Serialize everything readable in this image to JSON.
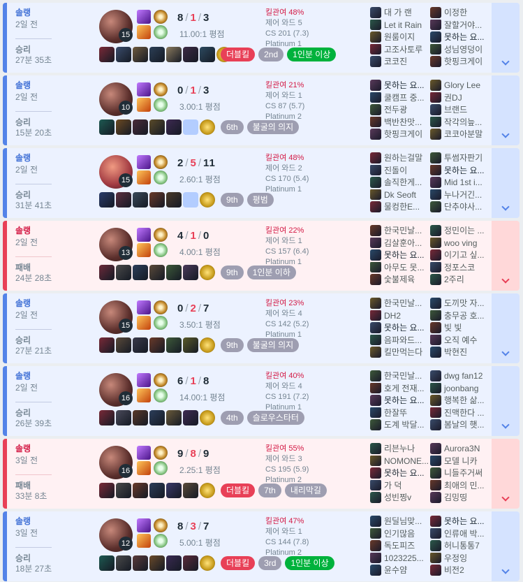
{
  "matches": [
    {
      "result": "win",
      "queue": "솔랭",
      "ago": "2일 전",
      "result_label": "승리",
      "duration": "27분 35초",
      "champion_level": "15",
      "kda": {
        "k": "8",
        "d": "1",
        "a": "3"
      },
      "ratio": "11.00:1 평점",
      "stats": {
        "kp": "킬관여 48%",
        "ward": "제어 와드 5",
        "cs": "CS 201 (7.3)",
        "tier": "Platinum 1"
      },
      "items": [
        "#7a2a38",
        "#3a4c6b",
        "#6f5a3e",
        "#2c3f56",
        "#8a7a5e",
        "#3c2a45",
        "#2d4a60"
      ],
      "tags": [
        {
          "text": "더블킬",
          "style": "mk"
        },
        {
          "text": "2nd",
          "style": "gy"
        },
        {
          "text": "1인분 이상",
          "style": "g2"
        }
      ],
      "team1": [
        "대 가 랜",
        "Let it Rain",
        "원룸이지",
        "고조사토루",
        "코코진"
      ],
      "team2": [
        "이정한",
        "잘할거야...",
        "못하는 요...",
        "성님영덩이",
        "핫핑크게이"
      ]
    },
    {
      "result": "win",
      "queue": "솔랭",
      "ago": "2일 전",
      "result_label": "승리",
      "duration": "15분 20초",
      "champion_level": "10",
      "kda": {
        "k": "0",
        "d": "1",
        "a": "3"
      },
      "ratio": "3.00:1 평점",
      "stats": {
        "kp": "킬관여 21%",
        "ward": "제어 와드 1",
        "cs": "CS 87 (5.7)",
        "tier": "Platinum 2"
      },
      "items": [
        "#1e5a52",
        "#6d4a22",
        "#4a2c3a",
        "#5b4b2a",
        "#3e2a52",
        "empty"
      ],
      "tags": [
        {
          "text": "6th",
          "style": "gy"
        },
        {
          "text": "불굴의 의지",
          "style": "gy"
        }
      ],
      "team1": [
        "못하는 요...",
        "쿨캠프 중...",
        "전두광",
        "백반찬맛...",
        "핫핑크게이"
      ],
      "team2": [
        "Glory Lee",
        "권DJ",
        "브랜드",
        "작각의늪...",
        "코코아분말"
      ]
    },
    {
      "result": "win",
      "queue": "솔랭",
      "ago": "2일 전",
      "result_label": "승리",
      "duration": "31분 41초",
      "champion_level": "15",
      "kda": {
        "k": "2",
        "d": "5",
        "a": "11"
      },
      "ratio": "2.60:1 평점",
      "stats": {
        "kp": "킬관여 48%",
        "ward": "제어 와드 2",
        "cs": "CS 170 (5.4)",
        "tier": "Platinum 1"
      },
      "items": [
        "#2a3c6b",
        "#5c2f40",
        "#3a4a5a",
        "#6a3a2a",
        "#4a3a2a",
        "empty"
      ],
      "tags": [
        {
          "text": "9th",
          "style": "gy"
        },
        {
          "text": "평범",
          "style": "gy"
        }
      ],
      "team1": [
        "원하는걸말",
        "진돌이",
        "솔직한게...",
        "Dk Seoft",
        "물컹한E..."
      ],
      "team2": [
        "투썸자판기",
        "못하는 요...",
        "Mid 1st i...",
        "누나거긴...",
        "단추야사..."
      ]
    },
    {
      "result": "lose",
      "queue": "솔랭",
      "ago": "2일 전",
      "result_label": "패배",
      "duration": "24분 28초",
      "champion_level": "13",
      "kda": {
        "k": "4",
        "d": "1",
        "a": "0"
      },
      "ratio": "4.00:1 평점",
      "stats": {
        "kp": "킬관여 22%",
        "ward": "제어 와드 1",
        "cs": "CS 157 (6.4)",
        "tier": "Platinum 1"
      },
      "items": [
        "#6b2a3a",
        "#4a4a4a",
        "#2c3e5a",
        "#5a4a3a",
        "#3e5a3a",
        "#4a3a5a"
      ],
      "tags": [
        {
          "text": "9th",
          "style": "gy"
        },
        {
          "text": "1인분 이하",
          "style": "gy"
        }
      ],
      "team1": [
        "한국민날...",
        "김살훈아...",
        "못하는 요...",
        "아무도 못...",
        "숯불제육"
      ],
      "team2": [
        "정민이는 ...",
        "woo ving",
        "이기고 싶...",
        "정포스코",
        "2주리"
      ]
    },
    {
      "result": "win",
      "queue": "솔랭",
      "ago": "2일 전",
      "result_label": "승리",
      "duration": "27분 21초",
      "champion_level": "15",
      "kda": {
        "k": "0",
        "d": "2",
        "a": "7"
      },
      "ratio": "3.50:1 평점",
      "stats": {
        "kp": "킬관여 23%",
        "ward": "제어 와드 4",
        "cs": "CS 142 (5.2)",
        "tier": "Platinum 1"
      },
      "items": [
        "#7a2a38",
        "#5a4a3a",
        "#3a3a4a",
        "#6a3a2a",
        "#3e5a3a",
        "#5a5a2a"
      ],
      "tags": [
        {
          "text": "9th",
          "style": "gy"
        },
        {
          "text": "불굴의 의지",
          "style": "gy"
        }
      ],
      "team1": [
        "한국민날...",
        "DH2",
        "못하는 요...",
        "음파와드...",
        "킬만먹는다"
      ],
      "team2": [
        "도끼맛 자...",
        "충무공 호...",
        "빛 빛",
        "오직 예수",
        "박현진"
      ]
    },
    {
      "result": "win",
      "queue": "솔랭",
      "ago": "2일 전",
      "result_label": "승리",
      "duration": "26분 39초",
      "champion_level": "16",
      "kda": {
        "k": "6",
        "d": "1",
        "a": "8"
      },
      "ratio": "14.00:1 평점",
      "stats": {
        "kp": "킬관여 40%",
        "ward": "제어 와드 4",
        "cs": "CS 191 (7.2)",
        "tier": "Platinum 1"
      },
      "items": [
        "#7a2a38",
        "#4a4a5a",
        "#5a3a2a",
        "#2c3e5a",
        "#6a5a3a",
        "#3e2a52"
      ],
      "tags": [
        {
          "text": "4th",
          "style": "gy"
        },
        {
          "text": "슬로우스타터",
          "style": "gy"
        }
      ],
      "team1": [
        "한국민날...",
        "호게 전재...",
        "못하는 요...",
        "한잘뚜",
        "도계 박달..."
      ],
      "team2": [
        "dwg fan12",
        "joonbang",
        "행복한 삶...",
        "진맥한다 ...",
        "봄날의 햇..."
      ]
    },
    {
      "result": "lose",
      "queue": "솔랭",
      "ago": "3일 전",
      "result_label": "패배",
      "duration": "33분 8초",
      "champion_level": "16",
      "kda": {
        "k": "9",
        "d": "8",
        "a": "9"
      },
      "ratio": "2.25:1 평점",
      "stats": {
        "kp": "킬관여 55%",
        "ward": "제어 와드 3",
        "cs": "CS 195 (5.9)",
        "tier": "Platinum 2"
      },
      "items": [
        "#7a2a38",
        "#4a4a4a",
        "#6a3a2a",
        "#2c3e5a",
        "#3a3a6a",
        "#5a4a3a"
      ],
      "tags": [
        {
          "text": "더블킬",
          "style": "mk"
        },
        {
          "text": "7th",
          "style": "gy"
        },
        {
          "text": "내리막길",
          "style": "gy"
        }
      ],
      "team1": [
        "리븐누나",
        "NOMONE...",
        "못하는 요...",
        "가 덕",
        "성빈찡v"
      ],
      "team2": [
        "Aurora3N",
        "모델 니카",
        "니들주거써",
        "최애의 민...",
        "김밍띵"
      ]
    },
    {
      "result": "win",
      "queue": "솔랭",
      "ago": "3일 전",
      "result_label": "승리",
      "duration": "18분 27초",
      "champion_level": "12",
      "kda": {
        "k": "8",
        "d": "3",
        "a": "7"
      },
      "ratio": "5.00:1 평점",
      "stats": {
        "kp": "킬관여 47%",
        "ward": "제어 와드 1",
        "cs": "CS 144 (7.8)",
        "tier": "Platinum 2"
      },
      "items": [
        "#1e5a52",
        "#4a4a4a",
        "#5a3a3a",
        "#6a4a2a",
        "#3a2a52",
        "#5a2a3a"
      ],
      "tags": [
        {
          "text": "더블킬",
          "style": "mk"
        },
        {
          "text": "3rd",
          "style": "gy"
        },
        {
          "text": "1인분 이상",
          "style": "g2"
        }
      ],
      "team1": [
        "원딜님맞...",
        "인기많음",
        "독도피즈",
        "1023225...",
        "윤수얌"
      ],
      "team2": [
        "못하는 요...",
        "인류애 박...",
        "허니통통7",
        "우정잉",
        "비전2"
      ]
    }
  ],
  "me": "못하는 요..."
}
